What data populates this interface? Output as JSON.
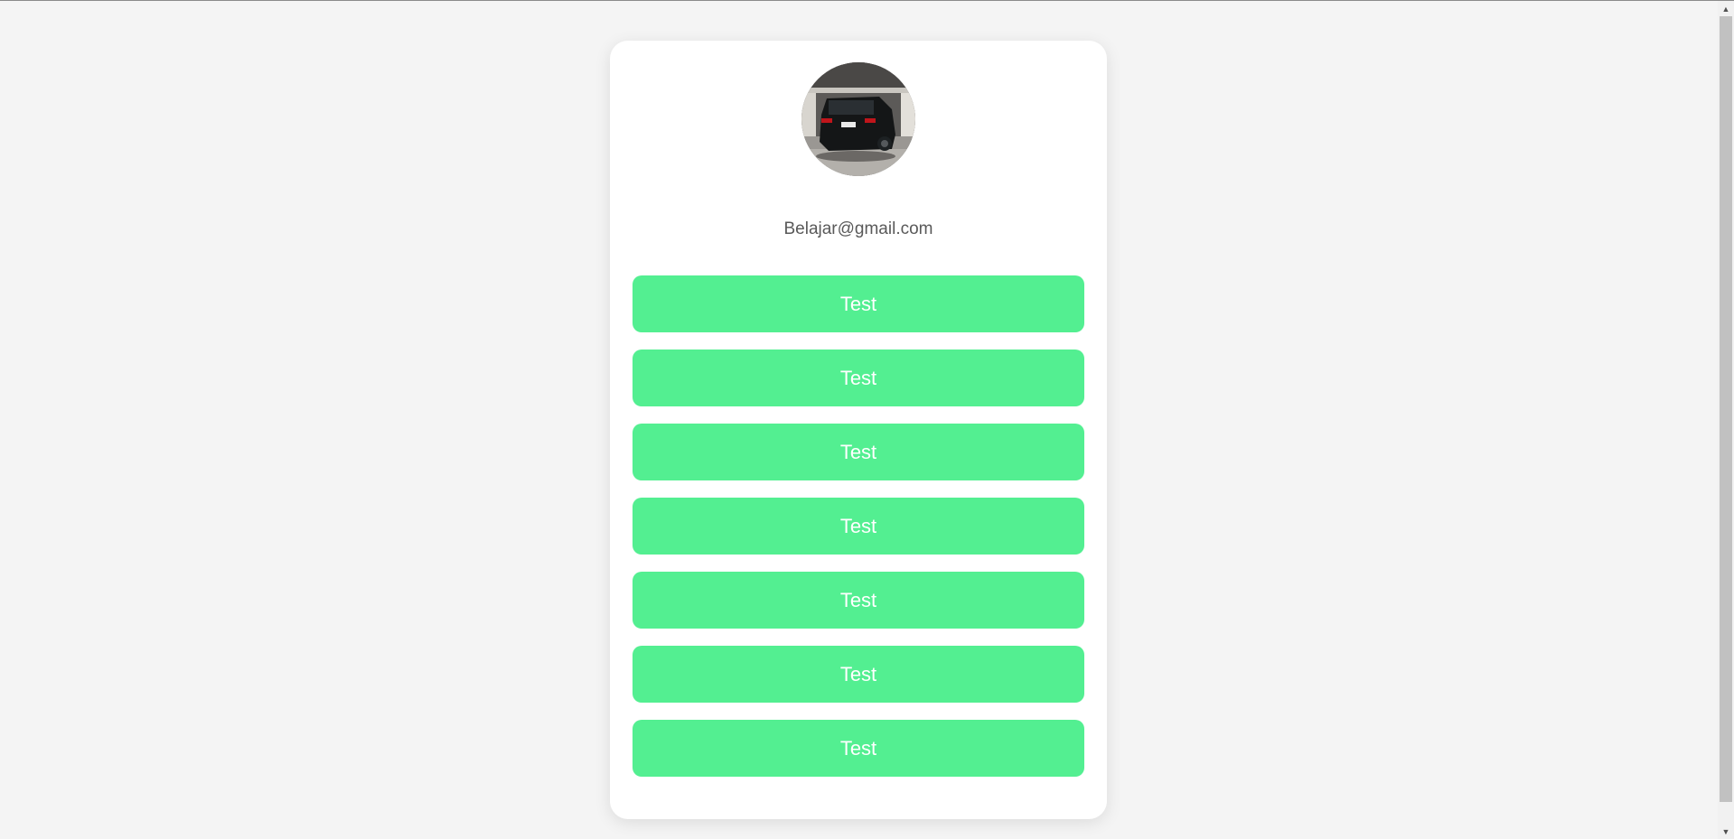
{
  "profile": {
    "avatar_icon": "car-photo",
    "email": "Belajar@gmail.com"
  },
  "links": [
    {
      "label": "Test"
    },
    {
      "label": "Test"
    },
    {
      "label": "Test"
    },
    {
      "label": "Test"
    },
    {
      "label": "Test"
    },
    {
      "label": "Test"
    },
    {
      "label": "Test"
    }
  ],
  "colors": {
    "background": "#f4f4f4",
    "card": "#ffffff",
    "button": "#53ef91",
    "button_text": "#ffffff",
    "email_text": "#595959"
  },
  "scrollbar": {
    "up_icon": "scroll-up-arrow-icon",
    "down_icon": "scroll-down-arrow-icon"
  }
}
